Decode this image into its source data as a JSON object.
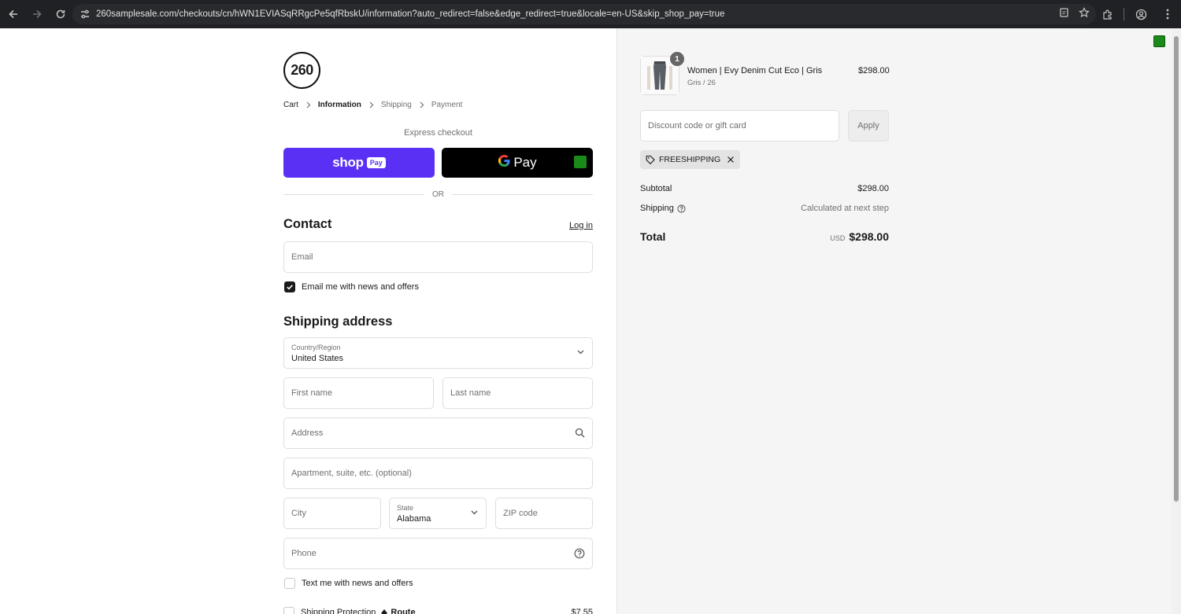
{
  "browser": {
    "url": "260samplesale.com/checkouts/cn/hWN1EVIASqRRgcPe5qfRbskU/information?auto_redirect=false&edge_redirect=true&locale=en-US&skip_shop_pay=true"
  },
  "brand": {
    "logo_text": "260"
  },
  "breadcrumbs": [
    {
      "label": "Cart",
      "state": "done"
    },
    {
      "label": "Information",
      "state": "current"
    },
    {
      "label": "Shipping",
      "state": "upcoming"
    },
    {
      "label": "Payment",
      "state": "upcoming"
    }
  ],
  "express": {
    "label": "Express checkout",
    "shop_word": "shop",
    "shop_pay_chip": "Pay",
    "gpay_g": "G",
    "gpay_text": "Pay",
    "or_text": "OR"
  },
  "contact": {
    "heading": "Contact",
    "login": "Log in",
    "email_placeholder": "Email",
    "newsletter_label": "Email me with news and offers",
    "newsletter_checked": true
  },
  "shipping": {
    "heading": "Shipping address",
    "country_label": "Country/Region",
    "country_value": "United States",
    "first_name_ph": "First name",
    "last_name_ph": "Last name",
    "address_ph": "Address",
    "apartment_ph": "Apartment, suite, etc. (optional)",
    "city_ph": "City",
    "state_label": "State",
    "state_value": "Alabama",
    "zip_ph": "ZIP code",
    "phone_ph": "Phone",
    "sms_label": "Text me with news and offers",
    "sms_checked": false,
    "protection_label": "Shipping Protection",
    "protection_brand": "Route",
    "protection_price": "$7.55"
  },
  "summary": {
    "item": {
      "quantity": "1",
      "name": "Women | Evy Denim Cut Eco | Gris",
      "variant": "Gris / 26",
      "price": "$298.00"
    },
    "discount_placeholder": "Discount code or gift card",
    "apply_label": "Apply",
    "applied_code": "FREESHIPPING",
    "subtotal_label": "Subtotal",
    "subtotal_value": "$298.00",
    "shipping_label": "Shipping",
    "shipping_value": "Calculated at next step",
    "total_label": "Total",
    "total_currency": "USD",
    "total_value": "$298.00"
  },
  "colors": {
    "shop_pay": "#5a31f4",
    "gpay": "#000000",
    "sidebar_bg": "#f5f5f5"
  }
}
